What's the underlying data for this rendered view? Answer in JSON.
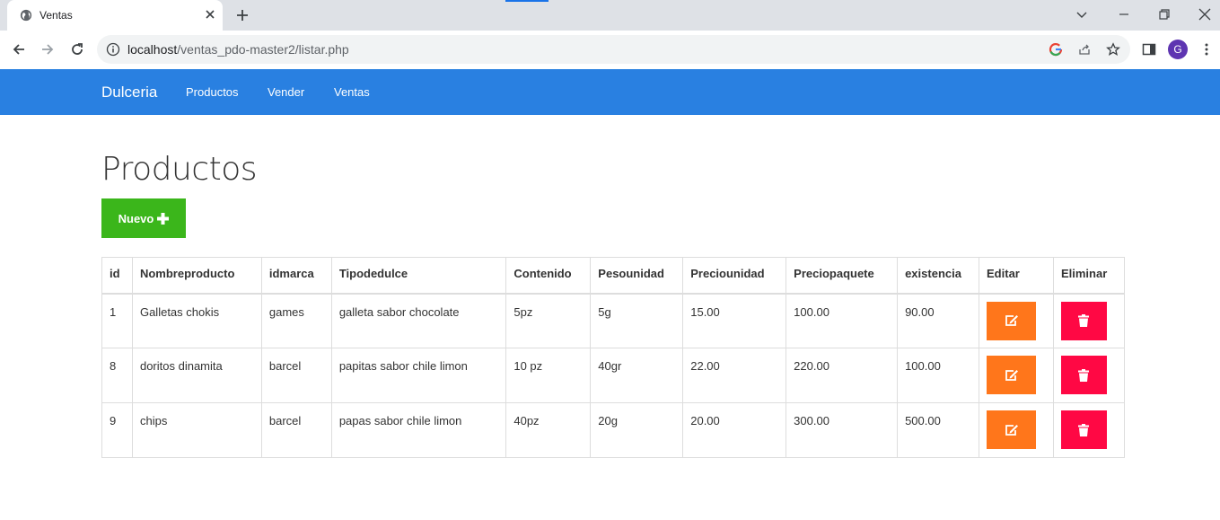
{
  "browser": {
    "tab_title": "Ventas",
    "url_host": "localhost",
    "url_path": "/ventas_pdo-master2/listar.php",
    "profile_initial": "G"
  },
  "navbar": {
    "brand": "Dulceria",
    "links": [
      "Productos",
      "Vender",
      "Ventas"
    ],
    "color": "#2980e1"
  },
  "main": {
    "title": "Productos",
    "new_button": "Nuevo"
  },
  "table": {
    "headers": [
      "id",
      "Nombreproducto",
      "idmarca",
      "Tipodedulce",
      "Contenido",
      "Pesounidad",
      "Preciounidad",
      "Preciopaquete",
      "existencia",
      "Editar",
      "Eliminar"
    ],
    "rows": [
      [
        "1",
        "Galletas chokis",
        "games",
        "galleta sabor chocolate",
        "5pz",
        "5g",
        "15.00",
        "100.00",
        "90.00"
      ],
      [
        "8",
        "doritos dinamita",
        "barcel",
        "papitas sabor chile limon",
        "10 pz",
        "40gr",
        "22.00",
        "220.00",
        "100.00"
      ],
      [
        "9",
        "chips",
        "barcel",
        "papas sabor chile limon",
        "40pz",
        "20g",
        "20.00",
        "300.00",
        "500.00"
      ]
    ]
  },
  "colors": {
    "new_button": "#3bb61b",
    "edit_button": "#ff761b",
    "delete_button": "#ff0844"
  },
  "icons": {
    "new": "plus-icon",
    "edit": "edit-icon",
    "delete": "trash-icon"
  }
}
